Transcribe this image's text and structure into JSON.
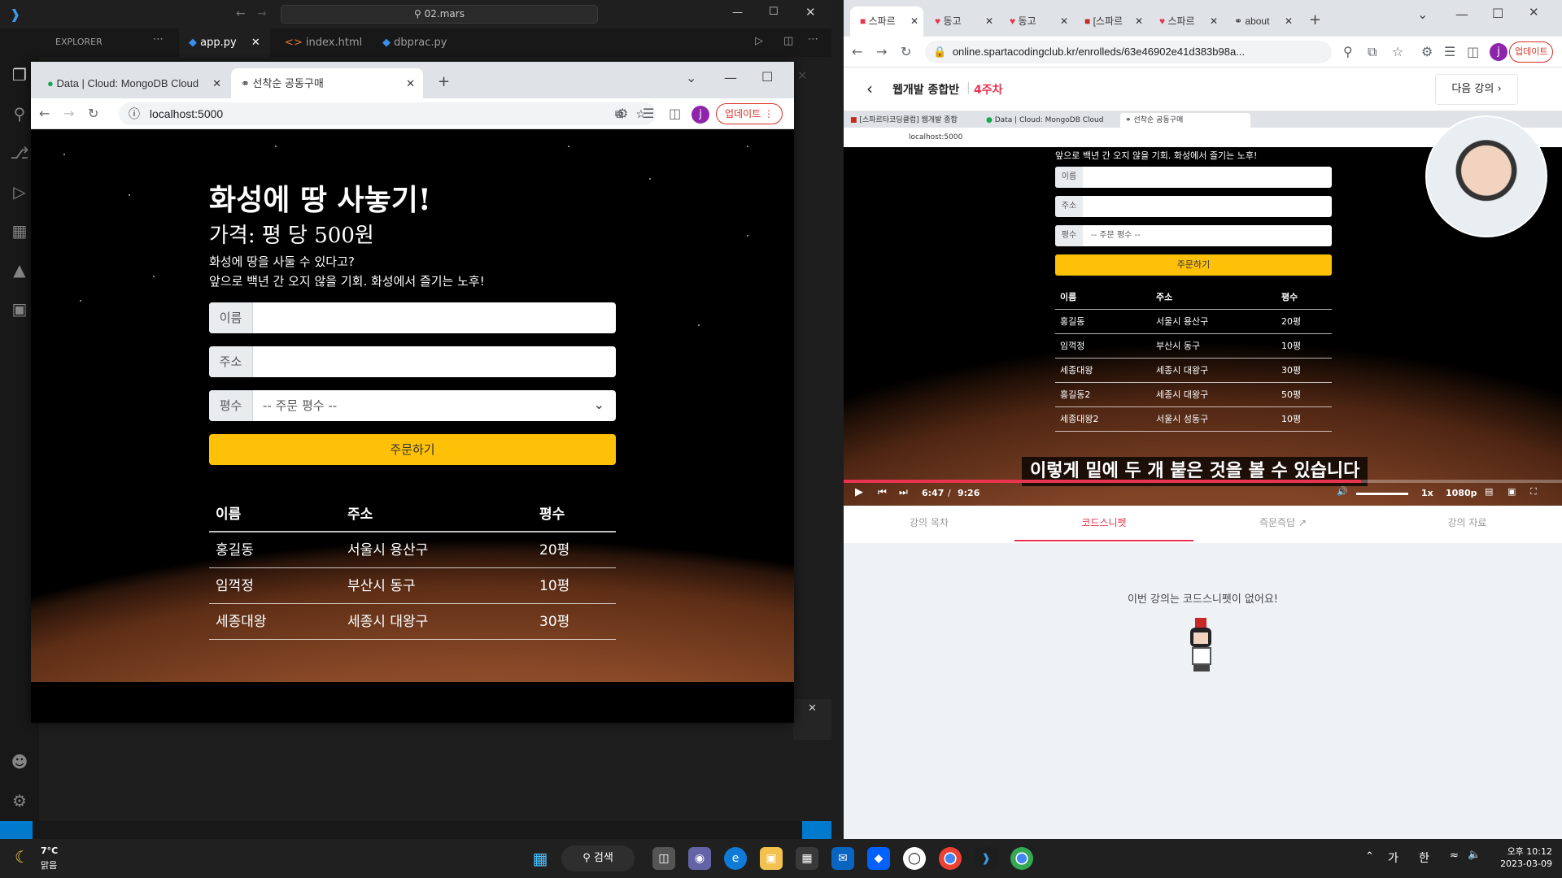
{
  "vscode": {
    "search": "02.mars",
    "explorer": "EXPLORER",
    "tabs": [
      {
        "label": "app.py"
      },
      {
        "label": "index.html"
      },
      {
        "label": "dbprac.py"
      }
    ]
  },
  "left_browser": {
    "tabs": [
      {
        "label": "Data | Cloud: MongoDB Cloud"
      },
      {
        "label": "선착순 공동구매"
      }
    ],
    "url": "localhost:5000",
    "profile": "j",
    "update_label": "업데이트",
    "page": {
      "title": "화성에 땅 사놓기!",
      "price": "가격: 평 당 500원",
      "desc1": "화성에 땅을 사둘 수 있다고?",
      "desc2": "앞으로 백년 간 오지 않을 기회. 화성에서 즐기는 노후!",
      "name_label": "이름",
      "address_label": "주소",
      "size_label": "평수",
      "size_placeholder": "-- 주문 평수 --",
      "order_button": "주문하기",
      "table_headers": [
        "이름",
        "주소",
        "평수"
      ],
      "rows": [
        [
          "홍길동",
          "서울시 용산구",
          "20평"
        ],
        [
          "임꺽정",
          "부산시 동구",
          "10평"
        ],
        [
          "세종대왕",
          "세종시 대왕구",
          "30평"
        ]
      ]
    }
  },
  "right_browser": {
    "tabs": [
      {
        "label": "스파르"
      },
      {
        "label": "동고"
      },
      {
        "label": "동고"
      },
      {
        "label": "[스파르"
      },
      {
        "label": "스파르"
      },
      {
        "label": "about"
      }
    ],
    "url": "online.spartacodingclub.kr/enrolleds/63e46902e41d383b98a...",
    "profile": "j",
    "update_label": "업데이트",
    "course_title": "웹개발 종합반",
    "course_week": "4주차",
    "next_lecture": "다음 강의",
    "video": {
      "inner_tabs": [
        {
          "label": "[스파르타코딩클럽] 웹개발 종합"
        },
        {
          "label": "Data | Cloud: MongoDB Cloud"
        },
        {
          "label": "선착순 공동구매"
        }
      ],
      "inner_url": "localhost:5000",
      "page_desc": "앞으로 백년 간 오지 않을 기회. 화성에서 즐기는 노후!",
      "name_label": "이름",
      "address_label": "주소",
      "size_label": "평수",
      "size_placeholder": "-- 주문 평수 --",
      "order_button": "주문하기",
      "table_headers": [
        "이름",
        "주소",
        "평수"
      ],
      "rows": [
        [
          "홍길동",
          "서울시 용산구",
          "20평"
        ],
        [
          "임꺽정",
          "부산시 동구",
          "10평"
        ],
        [
          "세종대왕",
          "세종시 대왕구",
          "30평"
        ],
        [
          "홍길동2",
          "세종시 대왕구",
          "50평"
        ],
        [
          "세종대왕2",
          "서울시 성동구",
          "10평"
        ]
      ],
      "subtitle": "이렇게 밑에 두 개 붙은 것을 볼 수 있습니다",
      "current_time": "6:47",
      "separator": "/",
      "duration": "9:26",
      "speed": "1x",
      "quality": "1080p",
      "progress": 0.72
    },
    "tabs_below": [
      {
        "label": "강의 목차"
      },
      {
        "label": "코드스니펫"
      },
      {
        "label": "즉문즉답"
      },
      {
        "label": "강의 자료"
      }
    ],
    "empty_message": "이번 강의는 코드스니펫이 없어요!"
  },
  "taskbar": {
    "weather_temp": "7°C",
    "weather_desc": "맑음",
    "search_label": "검색",
    "ime1": "가",
    "ime2": "한",
    "time": "오후 10:12",
    "date": "2023-03-09"
  },
  "colors": {
    "accent_red": "#e8344e",
    "mars_yellow": "#ffc107",
    "vscode_blue": "#007acc"
  }
}
